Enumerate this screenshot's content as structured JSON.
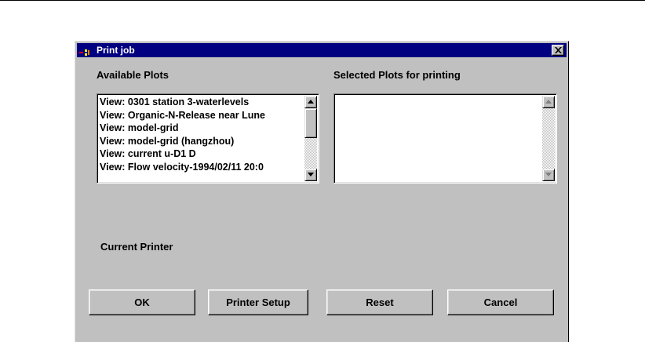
{
  "window": {
    "title": "Print job",
    "icon": "app-icon",
    "close_icon": "close-icon"
  },
  "available": {
    "label": "Available Plots",
    "items": [
      "View: 0301 station 3-waterlevels",
      "View: Organic-N-Release near Lune",
      "View: model-grid",
      "View: model-grid (hangzhou)",
      "View: current u-D1 D",
      "View: Flow velocity-1994/02/11 20:0"
    ]
  },
  "selected": {
    "label": "Selected Plots for printing",
    "items": []
  },
  "printer": {
    "label": "Current Printer"
  },
  "buttons": {
    "ok": "OK",
    "printer_setup": "Printer Setup",
    "reset": "Reset",
    "cancel": "Cancel"
  },
  "colors": {
    "titlebar": "#000080",
    "face": "#c0c0c0"
  }
}
